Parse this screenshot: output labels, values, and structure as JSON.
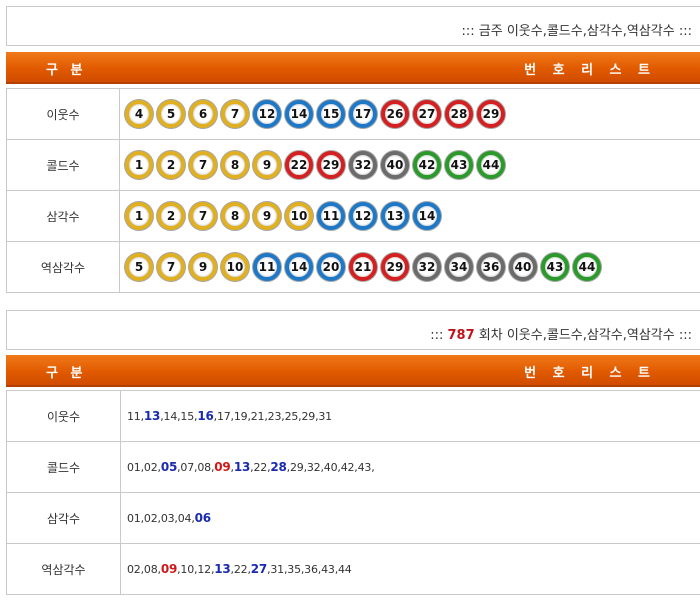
{
  "section1": {
    "title": "::: 금주 이웃수,콜드수,삼각수,역삼각수 :::",
    "header": {
      "col1": "구 분",
      "col2": "번 호 리 스 트"
    },
    "rows": [
      {
        "label": "이웃수",
        "balls": [
          {
            "n": "4",
            "c": "y"
          },
          {
            "n": "5",
            "c": "y"
          },
          {
            "n": "6",
            "c": "y"
          },
          {
            "n": "7",
            "c": "y"
          },
          {
            "n": "12",
            "c": "b"
          },
          {
            "n": "14",
            "c": "b"
          },
          {
            "n": "15",
            "c": "b"
          },
          {
            "n": "17",
            "c": "b"
          },
          {
            "n": "26",
            "c": "r"
          },
          {
            "n": "27",
            "c": "r"
          },
          {
            "n": "28",
            "c": "r"
          },
          {
            "n": "29",
            "c": "r"
          }
        ]
      },
      {
        "label": "콜드수",
        "balls": [
          {
            "n": "1",
            "c": "y"
          },
          {
            "n": "2",
            "c": "y"
          },
          {
            "n": "7",
            "c": "y"
          },
          {
            "n": "8",
            "c": "y"
          },
          {
            "n": "9",
            "c": "y"
          },
          {
            "n": "22",
            "c": "r"
          },
          {
            "n": "29",
            "c": "r"
          },
          {
            "n": "32",
            "c": "g"
          },
          {
            "n": "40",
            "c": "g"
          },
          {
            "n": "42",
            "c": "n"
          },
          {
            "n": "43",
            "c": "n"
          },
          {
            "n": "44",
            "c": "n"
          }
        ]
      },
      {
        "label": "삼각수",
        "balls": [
          {
            "n": "1",
            "c": "y"
          },
          {
            "n": "2",
            "c": "y"
          },
          {
            "n": "7",
            "c": "y"
          },
          {
            "n": "8",
            "c": "y"
          },
          {
            "n": "9",
            "c": "y"
          },
          {
            "n": "10",
            "c": "y"
          },
          {
            "n": "11",
            "c": "b"
          },
          {
            "n": "12",
            "c": "b"
          },
          {
            "n": "13",
            "c": "b"
          },
          {
            "n": "14",
            "c": "b"
          }
        ]
      },
      {
        "label": "역삼각수",
        "balls": [
          {
            "n": "5",
            "c": "y"
          },
          {
            "n": "7",
            "c": "y"
          },
          {
            "n": "9",
            "c": "y"
          },
          {
            "n": "10",
            "c": "y"
          },
          {
            "n": "11",
            "c": "b"
          },
          {
            "n": "14",
            "c": "b"
          },
          {
            "n": "20",
            "c": "b"
          },
          {
            "n": "21",
            "c": "r"
          },
          {
            "n": "29",
            "c": "r"
          },
          {
            "n": "32",
            "c": "g"
          },
          {
            "n": "34",
            "c": "g"
          },
          {
            "n": "36",
            "c": "g"
          },
          {
            "n": "40",
            "c": "g"
          },
          {
            "n": "43",
            "c": "n"
          },
          {
            "n": "44",
            "c": "n"
          }
        ]
      }
    ]
  },
  "section2": {
    "title_prefix": ":::",
    "round": "787",
    "title_suffix": "회차 이웃수,콜드수,삼각수,역삼각수 :::",
    "header": {
      "col1": "구 분",
      "col2": "번 호 리 스 트"
    },
    "rows": [
      {
        "label": "이웃수",
        "nums": [
          {
            "t": "11"
          },
          {
            "t": "13",
            "h": "b"
          },
          {
            "t": "14"
          },
          {
            "t": "15"
          },
          {
            "t": "16",
            "h": "b"
          },
          {
            "t": "17"
          },
          {
            "t": "19"
          },
          {
            "t": "21"
          },
          {
            "t": "23"
          },
          {
            "t": "25"
          },
          {
            "t": "29"
          },
          {
            "t": "31"
          }
        ],
        "trail": ""
      },
      {
        "label": "콜드수",
        "nums": [
          {
            "t": "01"
          },
          {
            "t": "02"
          },
          {
            "t": "05",
            "h": "b"
          },
          {
            "t": "07"
          },
          {
            "t": "08"
          },
          {
            "t": "09",
            "h": "r"
          },
          {
            "t": "13",
            "h": "b"
          },
          {
            "t": "22"
          },
          {
            "t": "28",
            "h": "b"
          },
          {
            "t": "29"
          },
          {
            "t": "32"
          },
          {
            "t": "40"
          },
          {
            "t": "42"
          },
          {
            "t": "43"
          }
        ],
        "trail": ","
      },
      {
        "label": "삼각수",
        "nums": [
          {
            "t": "01"
          },
          {
            "t": "02"
          },
          {
            "t": "03"
          },
          {
            "t": "04"
          },
          {
            "t": "06",
            "h": "b"
          }
        ],
        "trail": ""
      },
      {
        "label": "역삼각수",
        "nums": [
          {
            "t": "02"
          },
          {
            "t": "08"
          },
          {
            "t": "09",
            "h": "r"
          },
          {
            "t": "10"
          },
          {
            "t": "12"
          },
          {
            "t": "13",
            "h": "b"
          },
          {
            "t": "22"
          },
          {
            "t": "27",
            "h": "b"
          },
          {
            "t": "31"
          },
          {
            "t": "35"
          },
          {
            "t": "36"
          },
          {
            "t": "43"
          },
          {
            "t": "44"
          }
        ],
        "trail": ""
      }
    ]
  },
  "colors": {
    "header_orange": "#e15a00",
    "round_red": "#c0141c",
    "highlight_blue": "#1a2bb0",
    "highlight_red": "#d01818"
  }
}
